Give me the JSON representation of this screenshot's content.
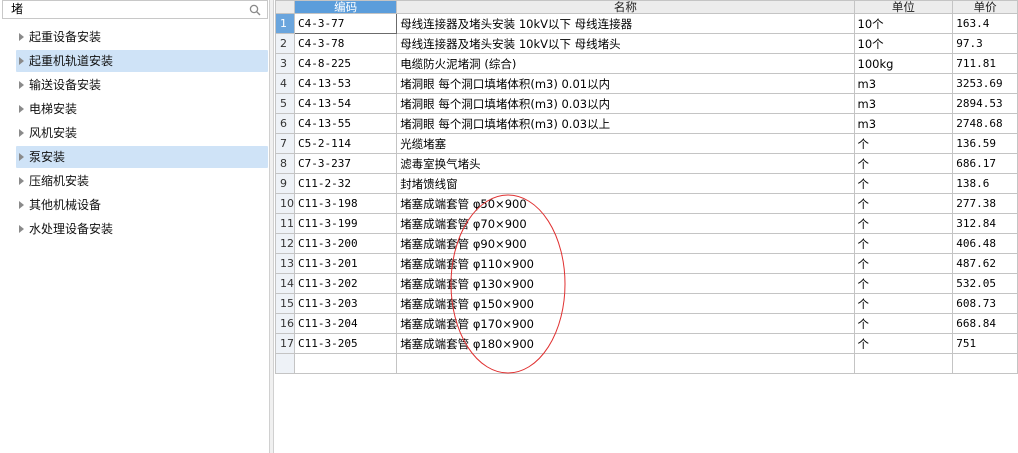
{
  "search": {
    "value": "堵",
    "placeholder": ""
  },
  "tree": {
    "items": [
      {
        "label": "起重设备安装",
        "selected": false
      },
      {
        "label": "起重机轨道安装",
        "selected": true
      },
      {
        "label": "输送设备安装",
        "selected": false
      },
      {
        "label": "电梯安装",
        "selected": false
      },
      {
        "label": "风机安装",
        "selected": false
      },
      {
        "label": "泵安装",
        "selected": true
      },
      {
        "label": "压缩机安装",
        "selected": false
      },
      {
        "label": "其他机械设备",
        "selected": false
      },
      {
        "label": "水处理设备安装",
        "selected": false
      }
    ]
  },
  "grid": {
    "headers": {
      "code": "编码",
      "name": "名称",
      "unit": "单位",
      "price": "单价"
    },
    "rows": [
      {
        "num": "1",
        "code": "C4-3-77",
        "name": "母线连接器及堵头安装 10kV以下 母线连接器",
        "unit": "10个",
        "price": "163.4"
      },
      {
        "num": "2",
        "code": "C4-3-78",
        "name": "母线连接器及堵头安装 10kV以下 母线堵头",
        "unit": "10个",
        "price": "97.3"
      },
      {
        "num": "3",
        "code": "C4-8-225",
        "name": "电缆防火泥堵洞 (综合)",
        "unit": "100kg",
        "price": "711.81"
      },
      {
        "num": "4",
        "code": "C4-13-53",
        "name": "堵洞眼 每个洞口填堵体积(m3) 0.01以内",
        "unit": "m3",
        "price": "3253.69"
      },
      {
        "num": "5",
        "code": "C4-13-54",
        "name": "堵洞眼 每个洞口填堵体积(m3) 0.03以内",
        "unit": "m3",
        "price": "2894.53"
      },
      {
        "num": "6",
        "code": "C4-13-55",
        "name": "堵洞眼 每个洞口填堵体积(m3) 0.03以上",
        "unit": "m3",
        "price": "2748.68"
      },
      {
        "num": "7",
        "code": "C5-2-114",
        "name": "光缆堵塞",
        "unit": "个",
        "price": "136.59"
      },
      {
        "num": "8",
        "code": "C7-3-237",
        "name": "滤毒室换气堵头",
        "unit": "个",
        "price": "686.17"
      },
      {
        "num": "9",
        "code": "C11-2-32",
        "name": "封堵馈线窗",
        "unit": "个",
        "price": "138.6"
      },
      {
        "num": "10",
        "code": "C11-3-198",
        "name": "堵塞成端套管 φ50×900",
        "unit": "个",
        "price": "277.38"
      },
      {
        "num": "11",
        "code": "C11-3-199",
        "name": "堵塞成端套管 φ70×900",
        "unit": "个",
        "price": "312.84"
      },
      {
        "num": "12",
        "code": "C11-3-200",
        "name": "堵塞成端套管 φ90×900",
        "unit": "个",
        "price": "406.48"
      },
      {
        "num": "13",
        "code": "C11-3-201",
        "name": "堵塞成端套管 φ110×900",
        "unit": "个",
        "price": "487.62"
      },
      {
        "num": "14",
        "code": "C11-3-202",
        "name": "堵塞成端套管 φ130×900",
        "unit": "个",
        "price": "532.05"
      },
      {
        "num": "15",
        "code": "C11-3-203",
        "name": "堵塞成端套管 φ150×900",
        "unit": "个",
        "price": "608.73"
      },
      {
        "num": "16",
        "code": "C11-3-204",
        "name": "堵塞成端套管 φ170×900",
        "unit": "个",
        "price": "668.84"
      },
      {
        "num": "17",
        "code": "C11-3-205",
        "name": "堵塞成端套管 φ180×900",
        "unit": "个",
        "price": "751"
      }
    ]
  },
  "colors": {
    "selection": "#cfe3f7",
    "header_active": "#5b9ddb",
    "annotation": "#e03030"
  }
}
